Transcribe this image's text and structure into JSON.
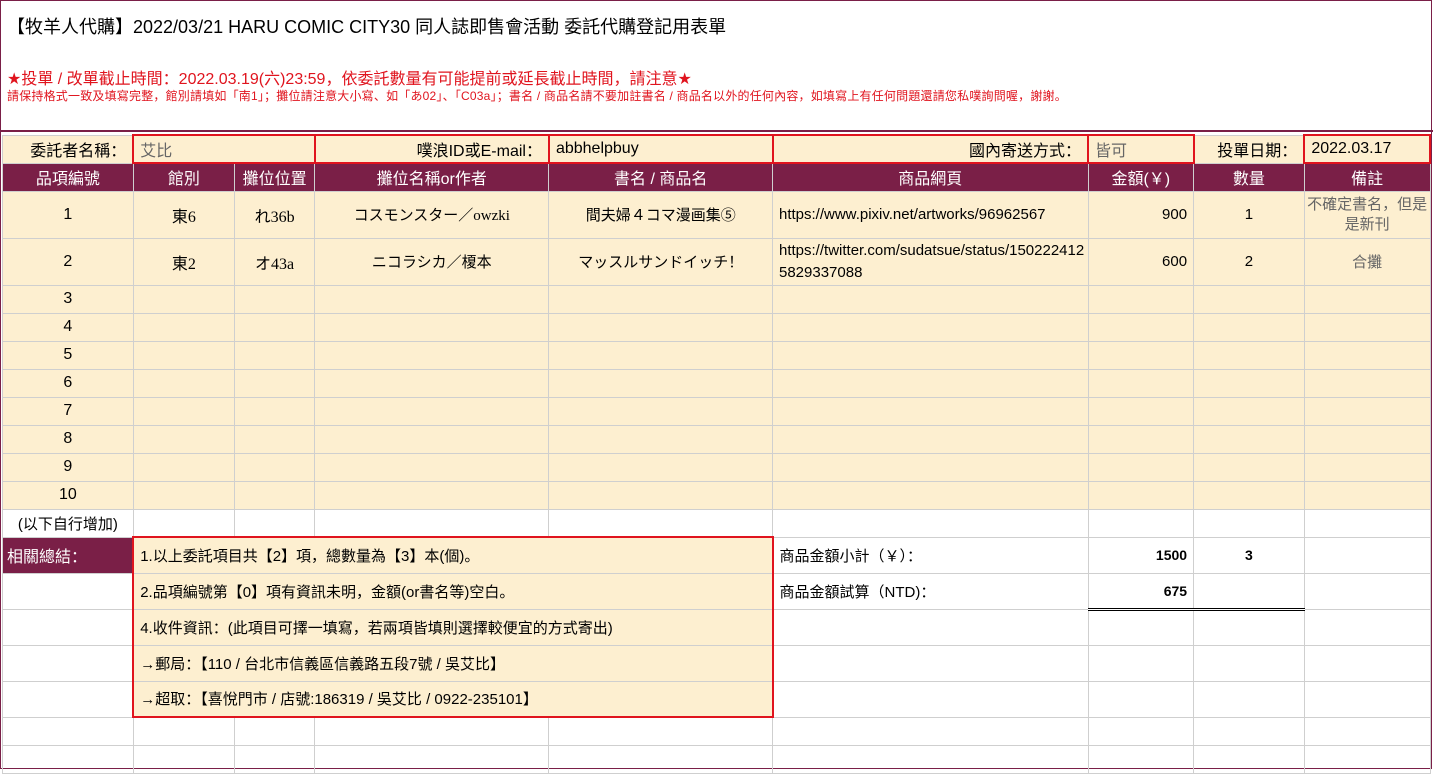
{
  "header": {
    "title": "【牧羊人代購】2022/03/21 HARU COMIC CITY30 同人誌即售會活動 委託代購登記用表單",
    "deadline": "★投單 / 改單截止時間：2022.03.19(六)23:59，依委託數量有可能提前或延長截止時間，請注意★",
    "note": "請保持格式一致及填寫完整，館別請填如「南1」；攤位請注意大小寫、如「あ02」、「C03a」；書名 / 商品名請不要加註書名 / 商品名以外的任何內容，如填寫上有任何問題還請您私噗詢問喔，謝謝。"
  },
  "client_row": {
    "name_label": "委託者名稱：",
    "name_value": "艾比",
    "plurk_label": "噗浪ID或E-mail：",
    "plurk_value": "abbhelpbuy",
    "ship_label": "國內寄送方式：",
    "ship_value": "皆可",
    "date_label": "投單日期：",
    "date_value": "2022.03.17"
  },
  "columns": [
    "品項編號",
    "館別",
    "攤位位置",
    "攤位名稱or作者",
    "書名 / 商品名",
    "商品網頁",
    "金額(￥)",
    "數量",
    "備註"
  ],
  "items": [
    {
      "no": "1",
      "hall": "東6",
      "booth": "れ36b",
      "circle": "コスモンスター／owzki",
      "title": "間夫婦４コマ漫画集⑤",
      "url": "https://www.pixiv.net/artworks/96962567",
      "price": "900",
      "qty": "1",
      "remark": "不確定書名，但是是新刊"
    },
    {
      "no": "2",
      "hall": "東2",
      "booth": "オ43a",
      "circle": "ニコラシカ／榎本",
      "title": "マッスルサンドイッチ！",
      "url": "https://twitter.com/sudatsue/status/1502224125829337088",
      "price": "600",
      "qty": "2",
      "remark": "合攤"
    },
    {
      "no": "3"
    },
    {
      "no": "4"
    },
    {
      "no": "5"
    },
    {
      "no": "6"
    },
    {
      "no": "7"
    },
    {
      "no": "8"
    },
    {
      "no": "9"
    },
    {
      "no": "10"
    }
  ],
  "add_more": "(以下自行增加)",
  "summary": {
    "label": "相關總結：",
    "line1": "1.以上委託項目共【2】項，總數量為【3】本(個)。",
    "line2": "2.品項編號第【0】項有資訊未明，金額(or書名等)空白。",
    "line4": "4.收件資訊：(此項目可擇一填寫，若兩項皆填則選擇較便宜的方式寄出)",
    "post": "→郵局：【110 / 台北市信義區信義路五段7號 / 吳艾比】",
    "store": "→超取：【喜悅門市 / 店號:186319 / 吳艾比 / 0922-235101】",
    "subtotal_label": "商品金額小計（￥）：",
    "subtotal_value": "1500",
    "subtotal_qty": "3",
    "ntd_label": "商品金額試算（NTD)：",
    "ntd_value": "675"
  },
  "colors": {
    "header_bg": "#7a1f47",
    "row_fill": "#fdefd0",
    "alert_red": "#e0141e"
  }
}
